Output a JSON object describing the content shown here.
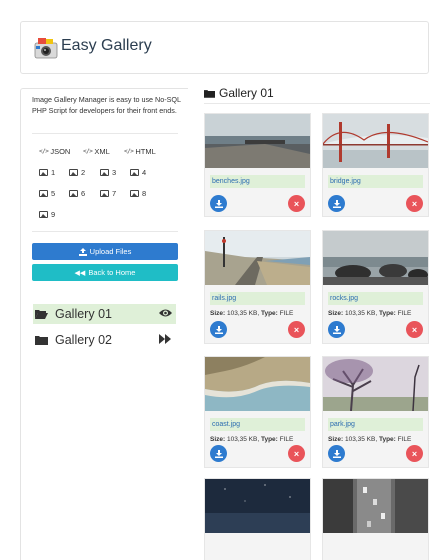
{
  "app": {
    "title": "Easy Gallery"
  },
  "sidebar": {
    "description": "Image Gallery Manager is easy to use No-SQL PHP Script for developers for their front ends.",
    "formats": [
      "JSON",
      "XML",
      "HTML"
    ],
    "page_numbers": [
      "1",
      "2",
      "3",
      "4",
      "5",
      "6",
      "7",
      "8",
      "9"
    ],
    "upload_label": "Upload Files",
    "home_label": "Back to Home",
    "galleries": [
      {
        "label": "Gallery 01",
        "active": true
      },
      {
        "label": "Gallery 02",
        "active": false
      }
    ]
  },
  "main": {
    "title": "Gallery 01",
    "cards": [
      {
        "file": "benches.jpg"
      },
      {
        "file": "bridge.jpg"
      },
      {
        "file": "rails.jpg",
        "size_label": "Size:",
        "size": "103,35 KB,",
        "type_label": "Type:",
        "type": "FILE"
      },
      {
        "file": "rocks.jpg",
        "size_label": "Size:",
        "size": "103,35 KB,",
        "type_label": "Type:",
        "type": "FILE"
      },
      {
        "file": "coast.jpg",
        "size_label": "Size:",
        "size": "103,35 KB,",
        "type_label": "Type:",
        "type": "FILE"
      },
      {
        "file": "park.jpg",
        "size_label": "Size:",
        "size": "103,35 KB,",
        "type_label": "Type:",
        "type": "FILE"
      },
      {
        "file": ""
      },
      {
        "file": ""
      }
    ]
  },
  "colors": {
    "primary": "#2e7bcf",
    "accent": "#1fbdc6",
    "danger": "#e9545a",
    "highlight": "#dff0d8"
  }
}
